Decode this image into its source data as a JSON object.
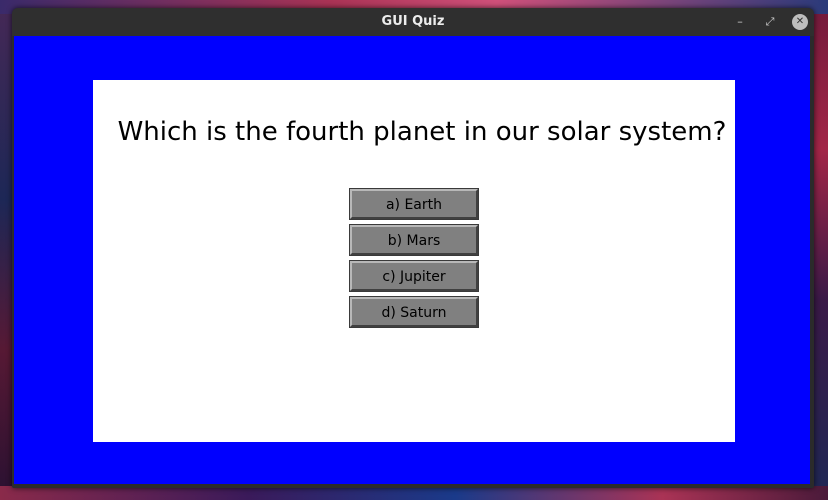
{
  "window": {
    "title": "GUI Quiz",
    "controls": {
      "minimize": "–",
      "maximize": "⤢",
      "close": "✕"
    }
  },
  "quiz": {
    "question": "Which is the fourth planet in our solar system?",
    "options": [
      "a) Earth",
      "b) Mars",
      "c) Jupiter",
      "d) Saturn"
    ]
  },
  "colors": {
    "background": "#0000ff",
    "panel": "#ffffff",
    "button": "#808080"
  }
}
